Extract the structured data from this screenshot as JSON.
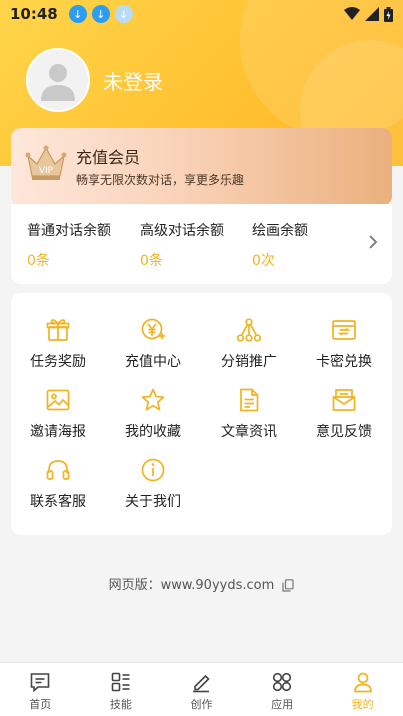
{
  "status_bar": {
    "time": "10:48"
  },
  "profile": {
    "login_label": "未登录"
  },
  "vip": {
    "title": "充值会员",
    "subtitle": "畅享无限次数对话，享更多乐趣",
    "badge": "VIP"
  },
  "quotas": [
    {
      "label": "普通对话余额",
      "value": "0条"
    },
    {
      "label": "高级对话余额",
      "value": "0条"
    },
    {
      "label": "绘画余额",
      "value": "0次"
    }
  ],
  "menu": [
    {
      "label": "任务奖励",
      "icon": "gift-icon"
    },
    {
      "label": "充值中心",
      "icon": "yen-recharge-icon"
    },
    {
      "label": "分销推广",
      "icon": "share-network-icon"
    },
    {
      "label": "卡密兑换",
      "icon": "card-exchange-icon"
    },
    {
      "label": "邀请海报",
      "icon": "image-icon"
    },
    {
      "label": "我的收藏",
      "icon": "star-icon"
    },
    {
      "label": "文章资讯",
      "icon": "document-icon"
    },
    {
      "label": "意见反馈",
      "icon": "feedback-icon"
    },
    {
      "label": "联系客服",
      "icon": "headset-icon"
    },
    {
      "label": "关于我们",
      "icon": "info-icon"
    }
  ],
  "footer": {
    "web_label": "网页版：www.90yyds.com"
  },
  "tabs": [
    {
      "label": "首页",
      "icon": "chat-icon"
    },
    {
      "label": "技能",
      "icon": "skills-icon"
    },
    {
      "label": "创作",
      "icon": "pen-icon"
    },
    {
      "label": "应用",
      "icon": "apps-icon"
    },
    {
      "label": "我的",
      "icon": "user-icon"
    }
  ],
  "colors": {
    "accent": "#f3b320",
    "header": "#ffc233"
  }
}
